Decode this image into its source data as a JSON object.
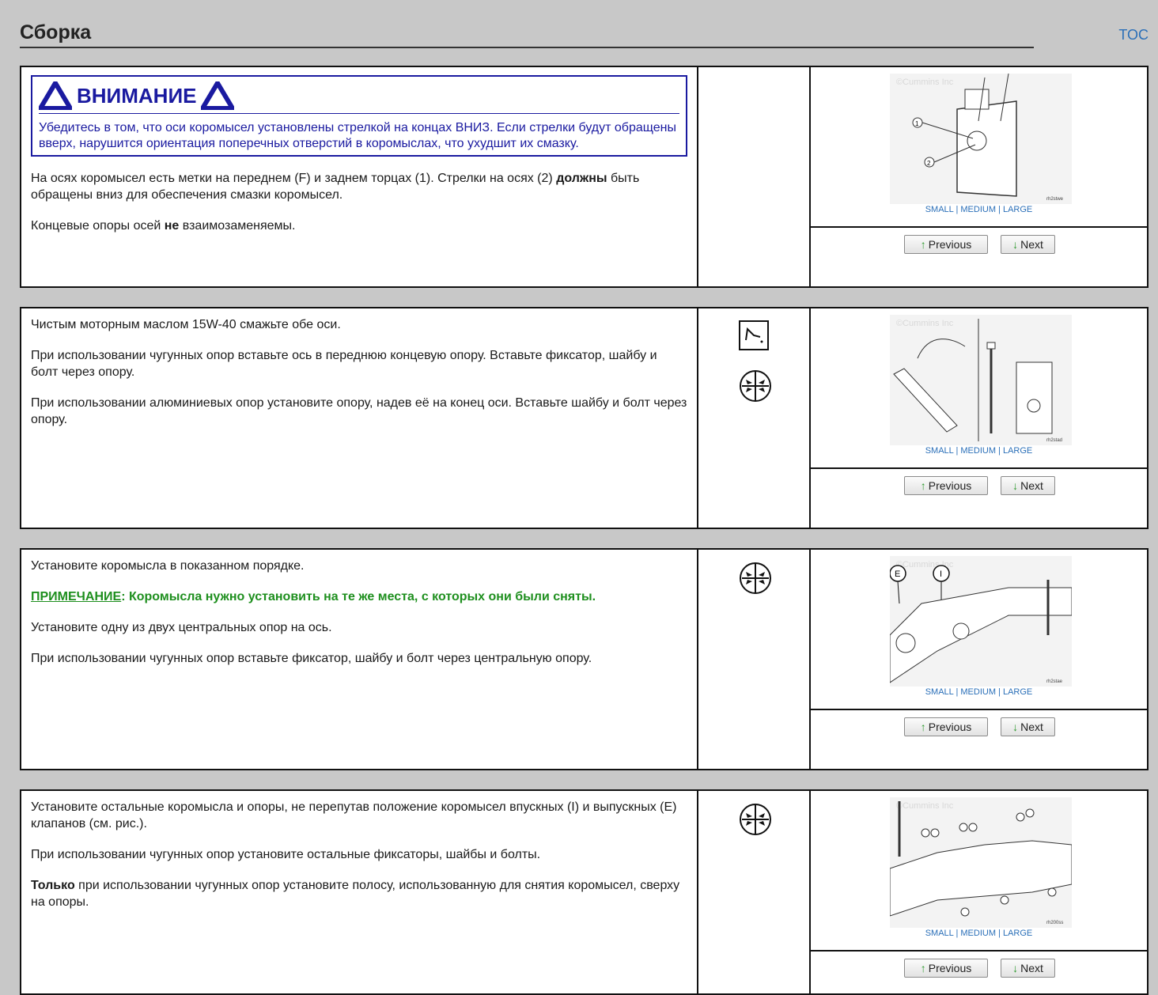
{
  "page": {
    "title": "Сборка",
    "toc": "TOC"
  },
  "steps": [
    {
      "warning_title": "ВНИМАНИЕ",
      "warning_text": "Убедитесь в том, что оси коромысел установлены стрелкой на концах ВНИЗ. Если стрелки будут обращены вверх, нарушится ориентация поперечных отверстий в коромыслах, что ухудшит их смазку.",
      "p1_a": "На осях коромысел есть метки на переднем (F) и заднем торцах (1). Стрелки на осях (2) ",
      "p1_b": "должны",
      "p1_c": " быть обращены вниз для обеспечения смазки коромысел.",
      "p2_a": "Концевые опоры осей ",
      "p2_b": "не",
      "p2_c": " взаимозаменяемы.",
      "figure": {
        "watermark": "©Cummins Inc",
        "code": "rh2stwe"
      }
    },
    {
      "p1": "Чистым моторным маслом 15W-40 смажьте обе оси.",
      "p2": "При использовании чугунных опор вставьте ось в переднюю концевую опору. Вставьте фиксатор, шайбу и болт через опору.",
      "p3": "При использовании алюминиевых опор установите опору, надев её на конец оси. Вставьте шайбу и болт через опору.",
      "figure": {
        "watermark": "©Cummins Inc",
        "code": "rh2stad"
      }
    },
    {
      "p1": "Установите коромысла в показанном порядке.",
      "note_label": "ПРИМЕЧАНИЕ",
      "note_text": ": Коромысла нужно установить на те же места, с которых они были сняты.",
      "p2": "Установите одну из двух центральных опор на ось.",
      "p3": "При использовании чугунных опор вставьте фиксатор, шайбу и болт через центральную опору.",
      "figure": {
        "watermark": "©Cummins Inc",
        "code": "rh2stae",
        "label_e": "E",
        "label_i": "I"
      }
    },
    {
      "p1": "Установите остальные коромысла и опоры, не перепутав положение коромысел впускных (I) и выпускных (E) клапанов (см. рис.).",
      "p2": "При использовании чугунных опор установите остальные фиксаторы, шайбы и болты.",
      "p3_a": "Только",
      "p3_b": " при использовании чугунных опор установите полосу, использованную для снятия коромысел, сверху на опоры.",
      "figure": {
        "watermark": "©Cummins Inc",
        "code": "rh200ss"
      }
    }
  ],
  "figure_links": {
    "small": "SMALL",
    "medium": "MEDIUM",
    "large": "LARGE",
    "sep": "|"
  },
  "nav": {
    "previous": "Previous",
    "next": "Next"
  },
  "icons": {
    "lubricate": "oil-can-icon",
    "tool": "wrench-tool-icon"
  },
  "colors": {
    "warning": "#1a1aa0",
    "note": "#1e8f1e",
    "link": "#2a6fb8"
  }
}
